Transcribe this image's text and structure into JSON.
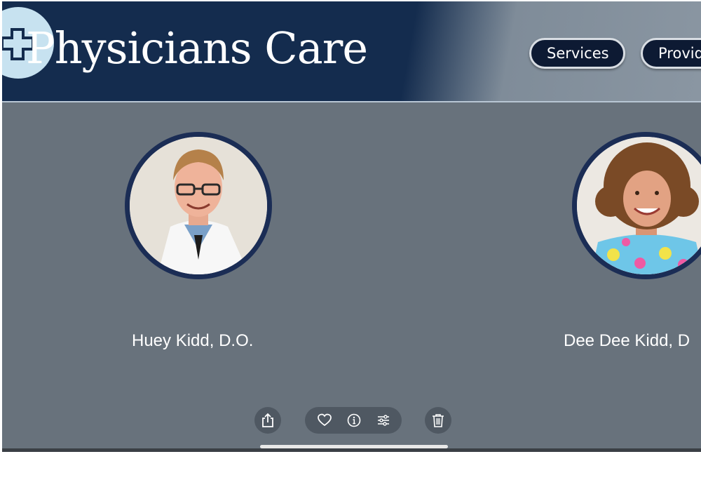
{
  "header": {
    "brand_title": "Physicians Care",
    "logo_icon": "medical-cross-icon",
    "brand_color": "#142c4e"
  },
  "nav": {
    "items": [
      {
        "label": "Services"
      },
      {
        "label": "Provid"
      }
    ]
  },
  "providers": [
    {
      "name": "Huey Kidd, D.O.",
      "photo": "provider-photo-huey-kidd"
    },
    {
      "name": "Dee Dee Kidd, D",
      "photo": "provider-photo-dee-dee-kidd"
    }
  ],
  "photo_viewer_toolbar": {
    "icons": [
      "share-icon",
      "heart-icon",
      "info-icon",
      "adjust-icon",
      "trash-icon"
    ]
  },
  "colors": {
    "page_background": "#68727c",
    "avatar_ring": "#1b2d55",
    "nav_button": "#0d1a33"
  }
}
